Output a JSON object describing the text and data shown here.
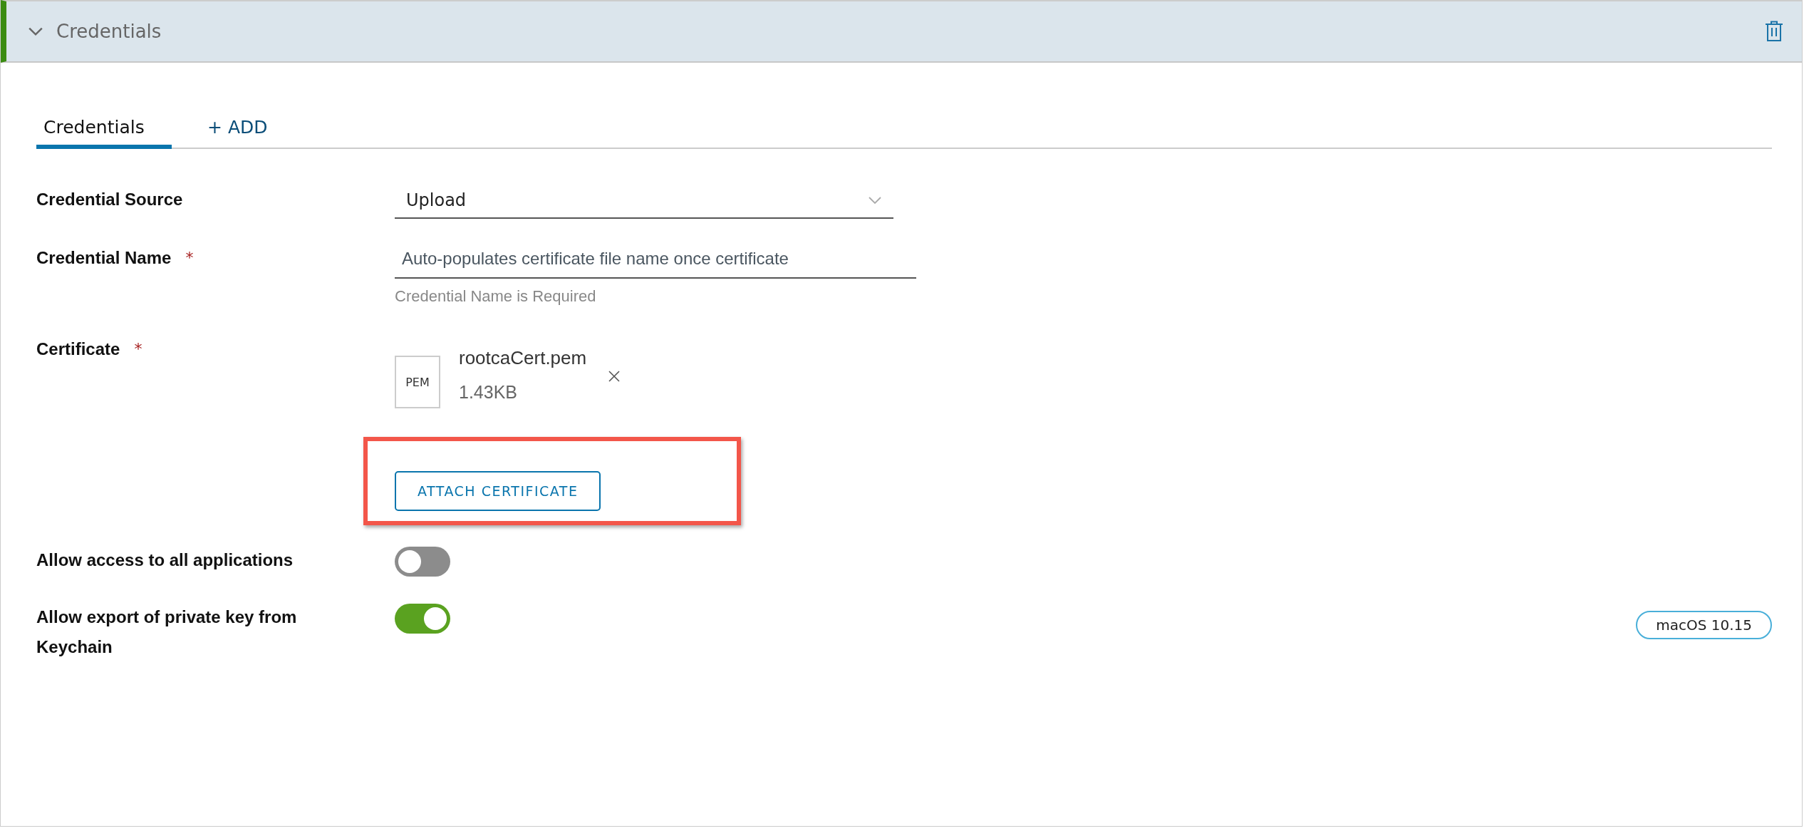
{
  "panel": {
    "title": "Credentials",
    "expanded": true
  },
  "tabs": [
    {
      "label": "Credentials",
      "selected": true
    },
    {
      "label": "+ ADD",
      "selected": false
    }
  ],
  "fields": [
    {
      "kind": "select",
      "label": "Credential Source",
      "value": "Upload"
    },
    {
      "kind": "text",
      "label": "Credential Name",
      "required_mark": "*",
      "placeholder": "Auto-populates certificate file name once certificate",
      "helper": "Credential Name is Required"
    },
    {
      "kind": "file",
      "label": "Certificate",
      "required_mark": "*",
      "file": {
        "type": "PEM",
        "name": "rootcaCert.pem",
        "size": "1.43KB"
      },
      "button": "ATTACH CERTIFICATE",
      "highlighted": true
    },
    {
      "kind": "toggle",
      "label": "Allow access to all applications",
      "on": false
    },
    {
      "kind": "toggle",
      "label": "Allow export of private key from Keychain",
      "on": true,
      "badge": "macOS 10.15"
    }
  ]
}
